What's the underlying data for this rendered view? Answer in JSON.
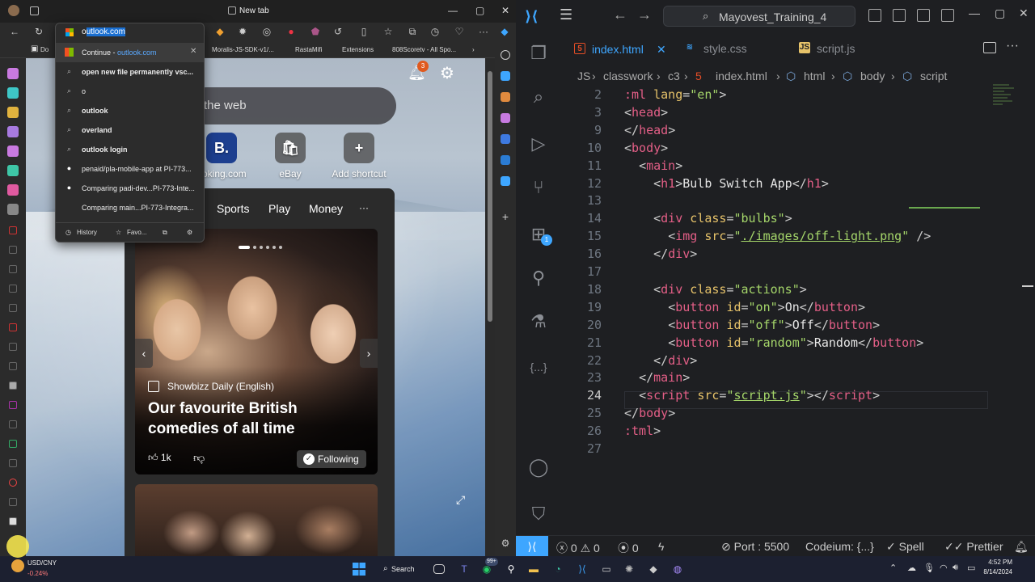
{
  "browser": {
    "tab_title": "New tab",
    "favorites": [
      "Do",
      "Moralis-JS-SDK-v1/...",
      "RastaMifi",
      "Extensions",
      "808Scoretv - All Spo..."
    ],
    "address": {
      "typed": "o",
      "autocomplete": "utlook.com"
    },
    "suggestions": [
      {
        "prefix": "Continue - ",
        "bold": "",
        "rest": "",
        "url": "outlook.com",
        "icon": "microsoft-icon",
        "highlighted": true
      },
      {
        "prefix": "",
        "bold": "open new file permanently vsc...",
        "rest": "",
        "url": "",
        "icon": "search-icon"
      },
      {
        "prefix": "",
        "bold": "o",
        "rest": "",
        "url": "",
        "icon": "search-icon"
      },
      {
        "prefix": "",
        "bold": "outlook",
        "rest": "",
        "url": "",
        "icon": "search-icon"
      },
      {
        "prefix": "",
        "bold": "overland",
        "rest": "",
        "url": "",
        "icon": "search-icon"
      },
      {
        "prefix": "",
        "bold": "outlook login",
        "rest": "",
        "url": "",
        "icon": "search-icon"
      },
      {
        "prefix": "penaid/pla-mobile-app at PI-773...",
        "bold": "",
        "rest": "",
        "url": "",
        "icon": "github-icon"
      },
      {
        "prefix": "Comparing padi-dev...PI-773-Inte...",
        "bold": "",
        "rest": "",
        "url": "",
        "icon": "github-icon"
      },
      {
        "prefix": "Comparing main...PI-773-Integra...",
        "bold": "",
        "rest": "",
        "url": "",
        "icon": "none"
      }
    ],
    "dropdown_footer": {
      "history": "History",
      "favorites": "Favo..."
    },
    "newtab": {
      "search_placeholder": "the web",
      "notification_count": "3",
      "shortcuts": [
        {
          "label": "ooking.com",
          "glyph": "B."
        },
        {
          "label": "eBay",
          "glyph": "🛍"
        },
        {
          "label": "Add shortcut",
          "glyph": "+"
        }
      ],
      "feed_tabs": [
        "Sports",
        "Play",
        "Money",
        "···"
      ],
      "card": {
        "source": "Showbizz Daily (English)",
        "headline": "Our favourite British comedies of all time",
        "likes": "1k",
        "follow": "Following"
      }
    }
  },
  "vscode": {
    "project": "Mayovest_Training_4",
    "tabs": [
      {
        "name": "index.html",
        "active": true,
        "icon": "html-icon",
        "color": "#e44d26"
      },
      {
        "name": "style.css",
        "active": false,
        "icon": "css-icon",
        "color": "#3ea6ff"
      },
      {
        "name": "script.js",
        "active": false,
        "icon": "js-icon",
        "color": "#e7c36a"
      }
    ],
    "breadcrumb": [
      "JS",
      "classwork",
      "c3",
      "index.html",
      "html",
      "body",
      "script"
    ],
    "lines": [
      {
        "n": "2",
        "html": "<span class='t-tag'>:ml</span> <span class='t-attr'>lang</span><span class='t-pun'>=</span><span class='t-str'>\"en\"</span><span class='t-pun'>&gt;</span>"
      },
      {
        "n": "3",
        "html": "<span class='t-pun'>&lt;</span><span class='t-tag'>head</span><span class='t-pun'>&gt;</span>"
      },
      {
        "n": "9",
        "html": "<span class='t-pun'>&lt;/</span><span class='t-tag'>head</span><span class='t-pun'>&gt;</span>"
      },
      {
        "n": "10",
        "html": "<span class='t-pun'>&lt;</span><span class='t-tag'>body</span><span class='t-pun'>&gt;</span>"
      },
      {
        "n": "11",
        "html": "  <span class='t-pun'>&lt;</span><span class='t-tag'>main</span><span class='t-pun'>&gt;</span>"
      },
      {
        "n": "12",
        "html": "    <span class='t-pun'>&lt;</span><span class='t-tag'>h1</span><span class='t-pun'>&gt;</span><span class='t-txt'>Bulb Switch App</span><span class='t-pun'>&lt;/</span><span class='t-tag'>h1</span><span class='t-pun'>&gt;</span>"
      },
      {
        "n": "13",
        "html": ""
      },
      {
        "n": "14",
        "html": "    <span class='t-pun'>&lt;</span><span class='t-tag'>div</span> <span class='t-attr'>class</span><span class='t-pun'>=</span><span class='t-str'>\"bulbs\"</span><span class='t-pun'>&gt;</span>"
      },
      {
        "n": "15",
        "html": "      <span class='t-pun'>&lt;</span><span class='t-tag'>img</span> <span class='t-attr'>src</span><span class='t-pun'>=</span><span class='t-str'>\"<span class='ul'>./images/off-light.png</span>\"</span> <span class='t-pun'>/&gt;</span>"
      },
      {
        "n": "16",
        "html": "    <span class='t-pun'>&lt;/</span><span class='t-tag'>div</span><span class='t-pun'>&gt;</span>"
      },
      {
        "n": "17",
        "html": ""
      },
      {
        "n": "18",
        "html": "    <span class='t-pun'>&lt;</span><span class='t-tag'>div</span> <span class='t-attr'>class</span><span class='t-pun'>=</span><span class='t-str'>\"actions\"</span><span class='t-pun'>&gt;</span>"
      },
      {
        "n": "19",
        "html": "      <span class='t-pun'>&lt;</span><span class='t-tag'>button</span> <span class='t-attr'>id</span><span class='t-pun'>=</span><span class='t-str'>\"on\"</span><span class='t-pun'>&gt;</span><span class='t-txt'>On</span><span class='t-pun'>&lt;/</span><span class='t-tag'>button</span><span class='t-pun'>&gt;</span>"
      },
      {
        "n": "20",
        "html": "      <span class='t-pun'>&lt;</span><span class='t-tag'>button</span> <span class='t-attr'>id</span><span class='t-pun'>=</span><span class='t-str'>\"off\"</span><span class='t-pun'>&gt;</span><span class='t-txt'>Off</span><span class='t-pun'>&lt;/</span><span class='t-tag'>button</span><span class='t-pun'>&gt;</span>"
      },
      {
        "n": "21",
        "html": "      <span class='t-pun'>&lt;</span><span class='t-tag'>button</span> <span class='t-attr'>id</span><span class='t-pun'>=</span><span class='t-str'>\"random\"</span><span class='t-pun'>&gt;</span><span class='t-txt'>Random</span><span class='t-pun'>&lt;/</span><span class='t-tag'>button</span><span class='t-pun'>&gt;</span>"
      },
      {
        "n": "22",
        "html": "    <span class='t-pun'>&lt;/</span><span class='t-tag'>div</span><span class='t-pun'>&gt;</span>"
      },
      {
        "n": "23",
        "html": "  <span class='t-pun'>&lt;/</span><span class='t-tag'>main</span><span class='t-pun'>&gt;</span>"
      },
      {
        "n": "24",
        "html": "  <span class='t-pun'>&lt;</span><span class='t-tag'>script</span> <span class='t-attr'>src</span><span class='t-pun'>=</span><span class='t-str'>\"<span class='ul'>script.js</span>\"</span><span class='t-pun'>&gt;&lt;/</span><span class='t-tag'>script</span><span class='t-pun'>&gt;</span>"
      },
      {
        "n": "25",
        "html": "<span class='t-pun'>&lt;/</span><span class='t-tag'>body</span><span class='t-pun'>&gt;</span>"
      },
      {
        "n": "26",
        "html": "<span class='t-tag'>:tml</span><span class='t-pun'>&gt;</span>"
      },
      {
        "n": "27",
        "html": ""
      }
    ],
    "current_line": "24",
    "status": {
      "errors": "0",
      "warnings": "0",
      "ports": "0",
      "port": "Port : 5500",
      "codeium": "Codeium: {...}",
      "spell": "Spell",
      "prettier": "Prettier"
    }
  },
  "taskbar": {
    "stock_name": "USD/CNY",
    "stock_change": "-0.24%",
    "search": "Search",
    "badge": "99+",
    "time": "4:52 PM",
    "date": "8/14/2024"
  }
}
